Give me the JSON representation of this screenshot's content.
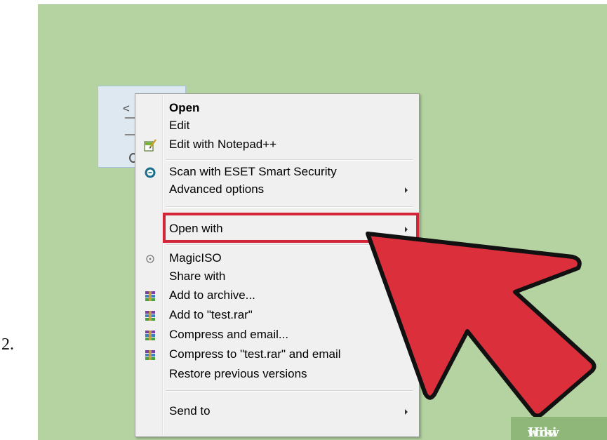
{
  "step_number": "2.",
  "desktop_icon": {
    "glyph": "<"
  },
  "context_menu": {
    "items": [
      {
        "label": "Open",
        "bold": true,
        "icon": "",
        "submenu": false
      },
      {
        "label": "Edit",
        "icon": "",
        "submenu": false
      },
      {
        "label": "Edit with Notepad++",
        "icon": "notepad-plus-plus-icon",
        "submenu": false
      },
      {
        "label": "Scan with ESET Smart Security",
        "icon": "eset-icon",
        "submenu": false
      },
      {
        "label": "Advanced options",
        "icon": "",
        "submenu": true
      },
      {
        "label": "Open with",
        "icon": "",
        "submenu": true,
        "highlighted": true
      },
      {
        "label": "MagicISO",
        "icon": "magiciso-icon",
        "submenu": false
      },
      {
        "label": "Share with",
        "icon": "",
        "submenu": false
      },
      {
        "label": "Add to archive...",
        "icon": "winrar-icon",
        "submenu": false
      },
      {
        "label": "Add to \"test.rar\"",
        "icon": "winrar-icon",
        "submenu": false
      },
      {
        "label": "Compress and email...",
        "icon": "winrar-icon",
        "submenu": false
      },
      {
        "label": "Compress to \"test.rar\" and email",
        "icon": "winrar-icon",
        "submenu": false
      },
      {
        "label": "Restore previous versions",
        "icon": "",
        "submenu": false
      },
      {
        "label": "Send to",
        "icon": "",
        "submenu": true
      }
    ]
  },
  "annotation": {
    "pointer": "red-arrow-icon",
    "highlight_color": "#d22638",
    "arrow_color": "#db2f3c"
  },
  "watermark": {
    "wiki": "wiki",
    "how": "How"
  }
}
